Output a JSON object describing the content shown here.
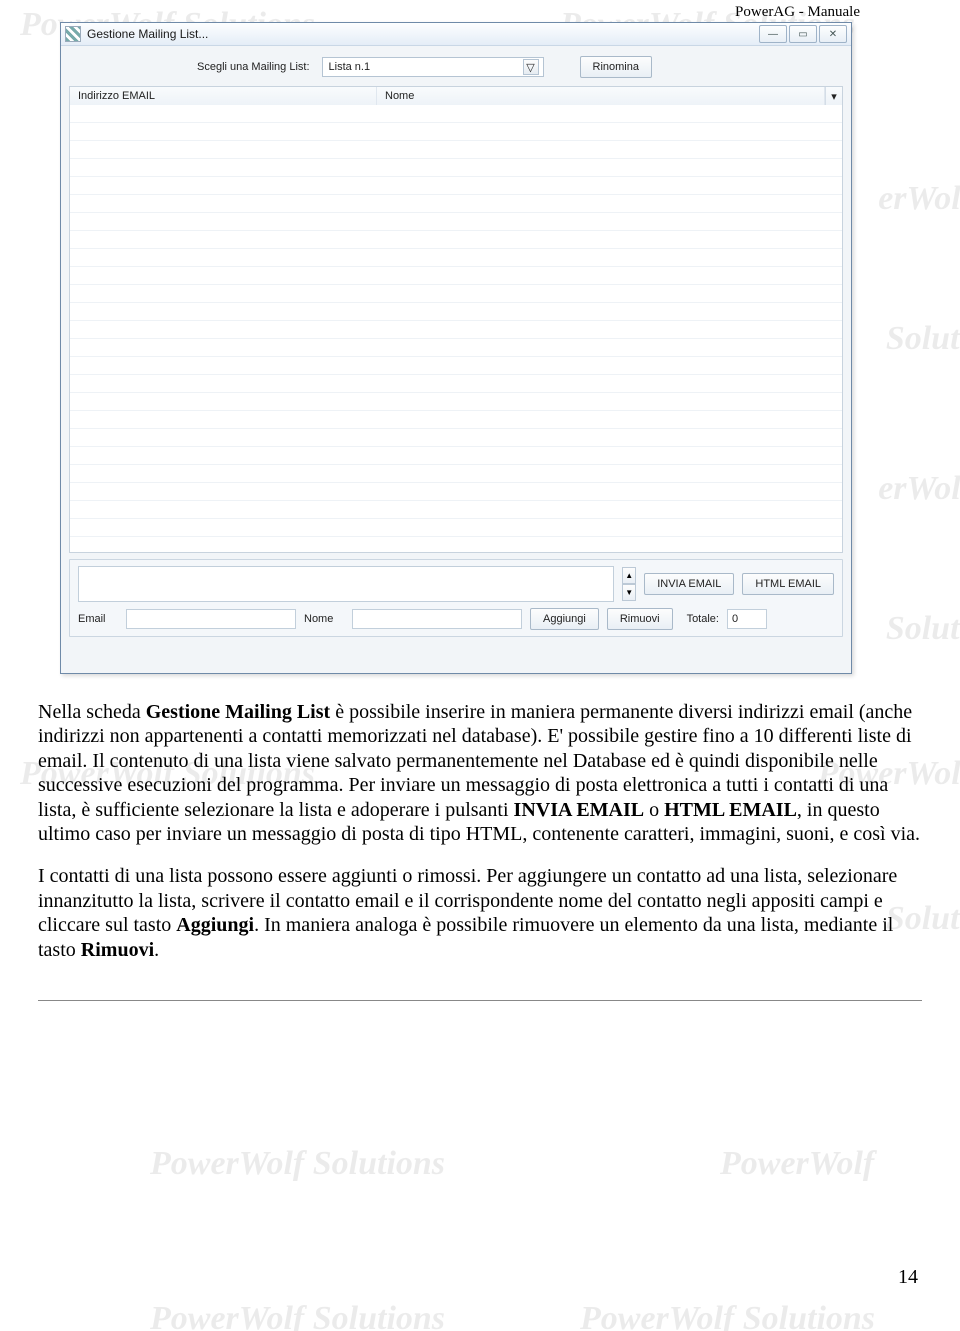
{
  "document": {
    "header": "PowerAG - Manuale",
    "watermark_full": "PowerWolf Solutions",
    "watermark_right": "PowerWolf",
    "watermark_er": "erWolf",
    "watermark_solutio": "Solutio",
    "page_number": "14"
  },
  "window": {
    "title": "Gestione Mailing List...",
    "minimize_glyph": "—",
    "maximize_glyph": "▭",
    "close_glyph": "✕",
    "select_label": "Scegli una Mailing List:",
    "select_value": "Lista n.1",
    "dropdown_glyph": "▽",
    "rename_button": "Rinomina",
    "columns": {
      "email": "Indirizzo EMAIL",
      "nome": "Nome"
    },
    "scroll_glyph": "▾",
    "buttons": {
      "invia": "INVIA EMAIL",
      "html": "HTML EMAIL",
      "aggiungi": "Aggiungi",
      "rimuovi": "Rimuovi"
    },
    "labels": {
      "email": "Email",
      "nome": "Nome",
      "totale": "Totale:"
    },
    "totale_value": "0",
    "spin_up": "▲",
    "spin_down": "▼"
  },
  "text": {
    "p1_a": "Nella scheda ",
    "p1_b": "Gestione Mailing List",
    "p1_c": " è possibile inserire in maniera permanente diversi indirizzi email (anche indirizzi non appartenenti a contatti memorizzati nel database). E' possibile gestire fino a 10 differenti liste di email. Il contenuto di una lista viene salvato permanentemente nel Database ed è quindi disponibile nelle successive esecuzioni del programma. Per inviare un messaggio di posta elettronica a tutti i contatti di una lista, è sufficiente selezionare la lista e adoperare i pulsanti ",
    "p1_d": "INVIA EMAIL",
    "p1_e": " o ",
    "p1_f": "HTML EMAIL",
    "p1_g": ", in questo ultimo caso per inviare un messaggio di posta di tipo HTML, contenente caratteri, immagini, suoni, e così via.",
    "p2_a": "I contatti di una lista possono essere aggiunti o rimossi. Per aggiungere un contatto ad una lista, selezionare innanzitutto la lista, scrivere il contatto email e il corrispondente nome del contatto negli appositi campi e cliccare sul tasto ",
    "p2_b": "Aggiungi",
    "p2_c": ". In maniera analoga è possibile rimuovere un elemento da una lista, mediante il tasto ",
    "p2_d": "Rimuovi",
    "p2_e": "."
  }
}
